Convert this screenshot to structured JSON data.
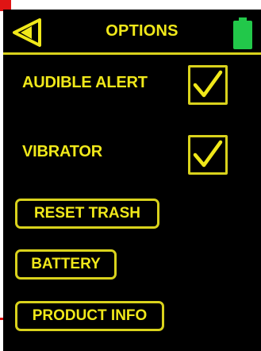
{
  "header": {
    "title": "OPTIONS",
    "back_icon": "back-arrow-icon",
    "battery_icon": "battery-full-icon"
  },
  "options": {
    "audible_alert": {
      "label": "AUDIBLE ALERT",
      "checked": true
    },
    "vibrator": {
      "label": "VIBRATOR",
      "checked": true
    }
  },
  "buttons": {
    "reset_trash": "RESET TRASH",
    "battery": "BATTERY",
    "product_info": "PRODUCT INFO"
  },
  "colors": {
    "accent": "#f0e81a",
    "outline": "#d9d21c",
    "battery": "#22c84a",
    "background": "#000000",
    "corner_marks": "#e01414"
  }
}
